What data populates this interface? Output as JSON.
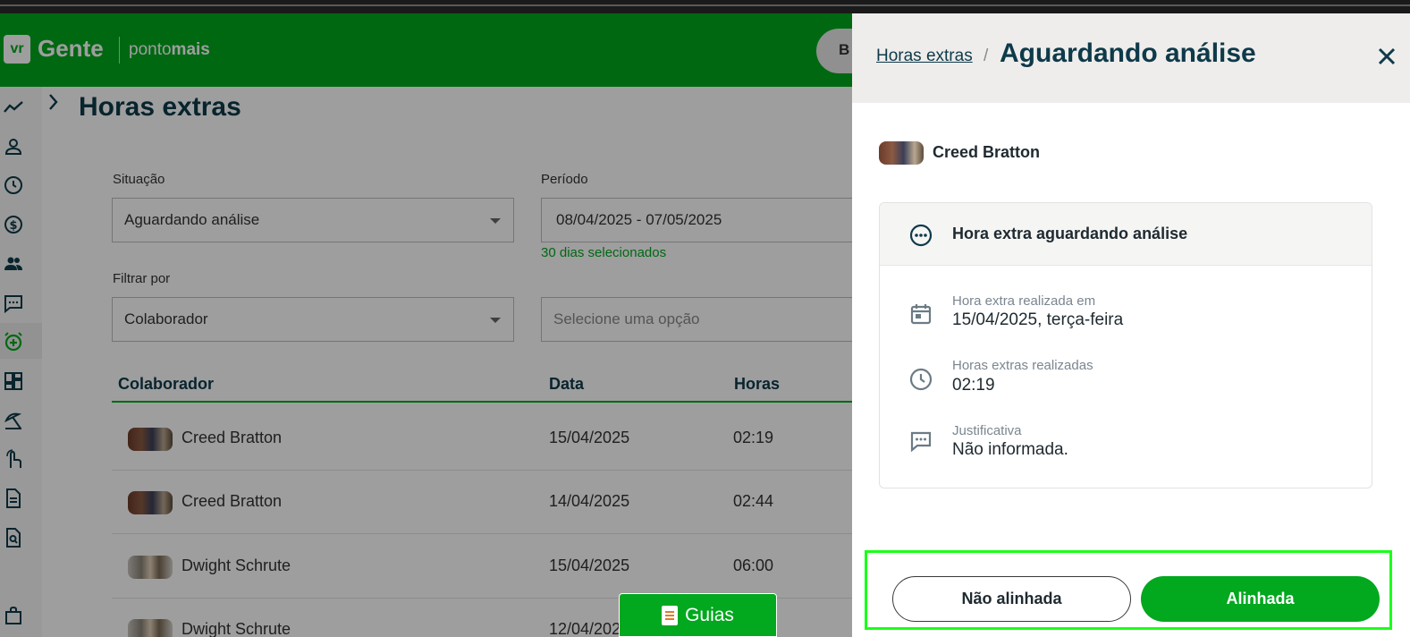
{
  "header": {
    "logo_mark": "vr",
    "logo_name": "Gente",
    "logo_sub_light": "ponto",
    "logo_sub_bold": "mais",
    "pill_text": "B"
  },
  "page": {
    "title": "Horas extras"
  },
  "filters": {
    "situacao_label": "Situação",
    "situacao_value": "Aguardando análise",
    "periodo_label": "Período",
    "periodo_value": "08/04/2025 - 07/05/2025",
    "periodo_hint": "30 dias selecionados",
    "filtrar_label": "Filtrar por",
    "filtrar_value": "Colaborador",
    "option_placeholder": "Selecione uma opção"
  },
  "table": {
    "columns": [
      "Colaborador",
      "Data",
      "Horas"
    ],
    "rows": [
      {
        "name": "Creed Bratton",
        "date": "15/04/2025",
        "hours": "02:19"
      },
      {
        "name": "Creed Bratton",
        "date": "14/04/2025",
        "hours": "02:44"
      },
      {
        "name": "Dwight Schrute",
        "date": "15/04/2025",
        "hours": "06:00"
      },
      {
        "name": "Dwight Schrute",
        "date": "12/04/2025",
        "hours": ""
      }
    ]
  },
  "guias": {
    "label": "Guias"
  },
  "drawer": {
    "breadcrumb_link": "Horas extras",
    "breadcrumb_sep": "/",
    "title": "Aguardando análise",
    "user_name": "Creed Bratton",
    "status_text": "Hora extra aguardando análise",
    "date_label": "Hora extra realizada em",
    "date_value": "15/04/2025, terça-feira",
    "hours_label": "Horas extras realizadas",
    "hours_value": "02:19",
    "justification_label": "Justificativa",
    "justification_value": "Não informada.",
    "btn_reject": "Não alinhada",
    "btn_accept": "Alinhada"
  },
  "colors": {
    "brand_green": "#02a81e",
    "title_navy": "#0e3a4a",
    "highlight": "#19ff19"
  },
  "icons": {
    "sidebar": [
      "chart-line-icon",
      "person-icon",
      "clock-icon",
      "dollar-icon",
      "people-icon",
      "chat-icon",
      "alarm-plus-icon",
      "dashboard-icon",
      "beach-icon",
      "touch-icon",
      "document-icon",
      "document-search-icon",
      "bag-icon"
    ]
  }
}
